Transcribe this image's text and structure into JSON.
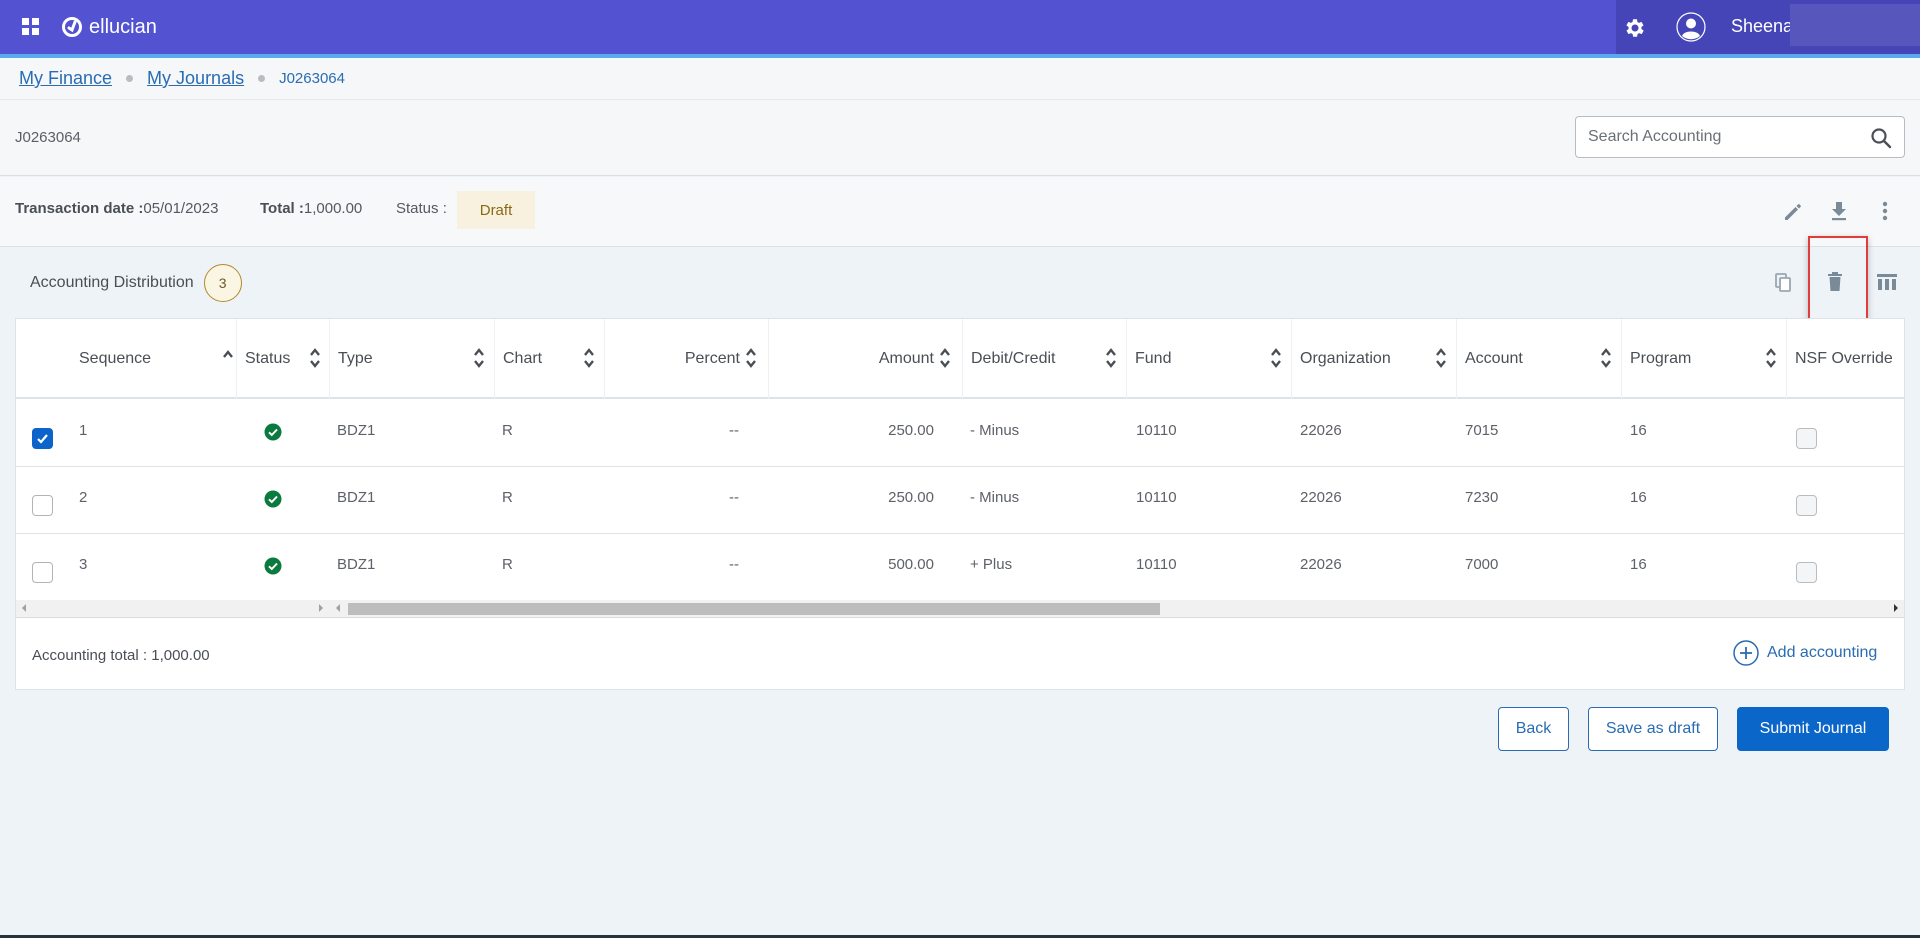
{
  "app": {
    "brand": "ellucian",
    "user_name": "Sheena"
  },
  "breadcrumb": {
    "items": [
      {
        "label": "My Finance",
        "link": true
      },
      {
        "label": "My Journals",
        "link": true
      },
      {
        "label": "J0263064",
        "link": false
      }
    ]
  },
  "page": {
    "journal_id": "J0263064",
    "search_placeholder": "Search Accounting"
  },
  "summary": {
    "transaction_date_label": "Transaction date :",
    "transaction_date_value": "05/01/2023",
    "total_label": "Total :",
    "total_value": "1,000.00",
    "status_label": "Status :",
    "status_value": "Draft",
    "actions": [
      "edit-icon",
      "download-icon",
      "more-vertical-icon"
    ]
  },
  "distribution": {
    "title": "Accounting Distribution",
    "count": "3",
    "actions": [
      "copy-icon",
      "delete-icon",
      "columns-icon"
    ],
    "columns": [
      "Sequence",
      "Status",
      "Type",
      "Chart",
      "Percent",
      "Amount",
      "Debit/Credit",
      "Fund",
      "Organization",
      "Account",
      "Program",
      "NSF Override"
    ],
    "rows": [
      {
        "selected": true,
        "sequence": "1",
        "status": "valid",
        "type": "BDZ1",
        "chart": "R",
        "percent": "--",
        "amount": "250.00",
        "debit_credit": "- Minus",
        "fund": "10110",
        "organization": "22026",
        "account": "7015",
        "program": "16",
        "nsf_override": false
      },
      {
        "selected": false,
        "sequence": "2",
        "status": "valid",
        "type": "BDZ1",
        "chart": "R",
        "percent": "--",
        "amount": "250.00",
        "debit_credit": "- Minus",
        "fund": "10110",
        "organization": "22026",
        "account": "7230",
        "program": "16",
        "nsf_override": false
      },
      {
        "selected": false,
        "sequence": "3",
        "status": "valid",
        "type": "BDZ1",
        "chart": "R",
        "percent": "--",
        "amount": "500.00",
        "debit_credit": "+ Plus",
        "fund": "10110",
        "organization": "22026",
        "account": "7000",
        "program": "16",
        "nsf_override": false
      }
    ],
    "accounting_total": "Accounting total : 1,000.00",
    "add_label": "Add accounting"
  },
  "footer_buttons": {
    "back": "Back",
    "save_draft": "Save as draft",
    "submit": "Submit Journal"
  },
  "colors": {
    "topbar": "#5353d1",
    "primary": "#0a66c8",
    "link": "#2a6cb3",
    "success": "#0b7a3e",
    "draft_badge_bg": "#f8f1df",
    "highlight": "#e23b3b"
  }
}
